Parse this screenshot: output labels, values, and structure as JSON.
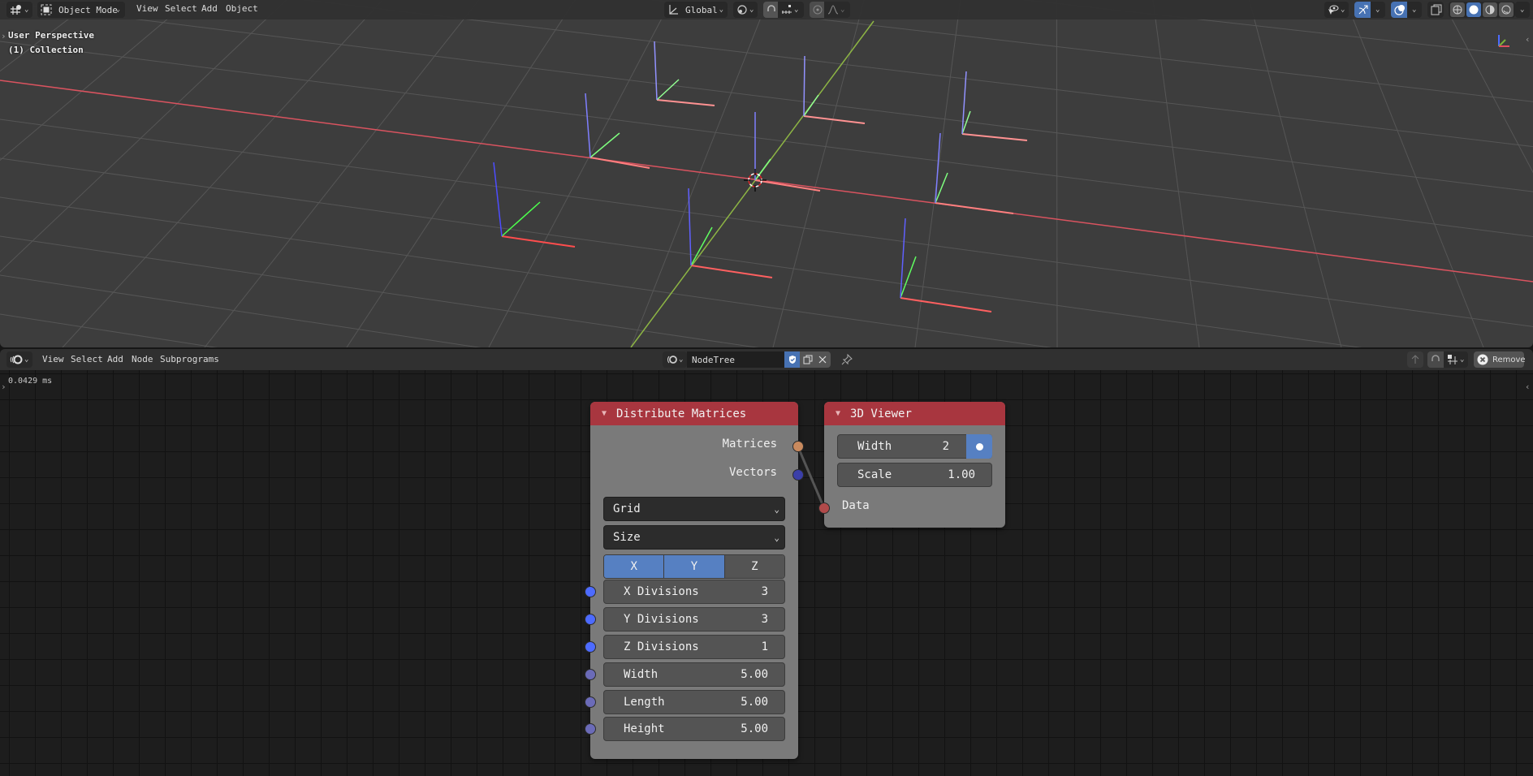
{
  "viewport": {
    "header": {
      "editor_type_icon": "view3d-icon",
      "mode_icon": "object-mode-icon",
      "mode": "Object Mode",
      "menus": [
        "View",
        "Select",
        "Add",
        "Object"
      ],
      "transform_orientation_icon": "orientation-global-icon",
      "transform_orientation": "Global",
      "pivot_icon": "pivot-point-icon",
      "snap_icon": "snap-magnet-icon",
      "snap_target_icon": "snap-increment-icon",
      "proportional_icon": "proportional-edit-icon",
      "falloff_icon": "falloff-curve-icon",
      "visibility_icon": "selectability-visibility-icon",
      "gizmo_icon": "gizmo-icon",
      "overlay_icon": "overlay-icon",
      "xray_icon": "xray-icon",
      "shading_modes": [
        "wireframe",
        "solid",
        "material-preview",
        "rendered"
      ],
      "active_shading": "solid"
    },
    "overlay_text": {
      "view_name": "User Perspective",
      "collection": "(1) Collection"
    },
    "colors": {
      "background": "#3d3d3d",
      "grid": "#565656",
      "x_axis": "#d9535f",
      "y_axis": "#8db544",
      "empty_x": "#ff4d4d",
      "empty_y": "#4dff4d",
      "empty_z": "#4d4dff"
    }
  },
  "node_editor": {
    "header": {
      "editor_type_icon": "node-editor-icon",
      "menus": [
        "View",
        "Select",
        "Add",
        "Node",
        "Subprograms"
      ],
      "tree_type_icon": "node-tree-icon",
      "tree_name": "NodeTree",
      "fake_user_icon": "fake-user-shield-icon",
      "duplicate_icon": "duplicate-icon",
      "unlink_icon": "close-icon",
      "pin_icon": "pin-icon",
      "parent_icon": "parent-tree-icon",
      "snap_icon": "snap-magnet-icon",
      "snap_target_icon": "snap-grid-icon",
      "remove_label": "Remove",
      "remove_icon": "remove-x-icon"
    },
    "timing": "0.0429 ms",
    "nodes": {
      "distribute": {
        "title": "Distribute Matrices",
        "outputs": [
          "Matrices",
          "Vectors"
        ],
        "mode": "Grid",
        "size_mode": "Size",
        "axes": [
          {
            "label": "X",
            "active": true
          },
          {
            "label": "Y",
            "active": true
          },
          {
            "label": "Z",
            "active": false
          }
        ],
        "inputs": [
          {
            "label": "X Divisions",
            "value": "3"
          },
          {
            "label": "Y Divisions",
            "value": "3"
          },
          {
            "label": "Z Divisions",
            "value": "1"
          },
          {
            "label": "Width",
            "value": "5.00"
          },
          {
            "label": "Length",
            "value": "5.00"
          },
          {
            "label": "Height",
            "value": "5.00"
          }
        ]
      },
      "viewer": {
        "title": "3D Viewer",
        "width_label": "Width",
        "width_value": "2",
        "scale_label": "Scale",
        "scale_value": "1.00",
        "input": "Data"
      }
    },
    "colors": {
      "node_header": "#a8363f",
      "node_body": "#7a7a7a",
      "socket_matrix": "#c98a5e",
      "socket_vector": "#3b3fa8",
      "socket_int": "#4d6bff",
      "socket_float": "#6b6bb8",
      "socket_data": "#b14a4a",
      "toggle_on": "#5680c2"
    }
  }
}
